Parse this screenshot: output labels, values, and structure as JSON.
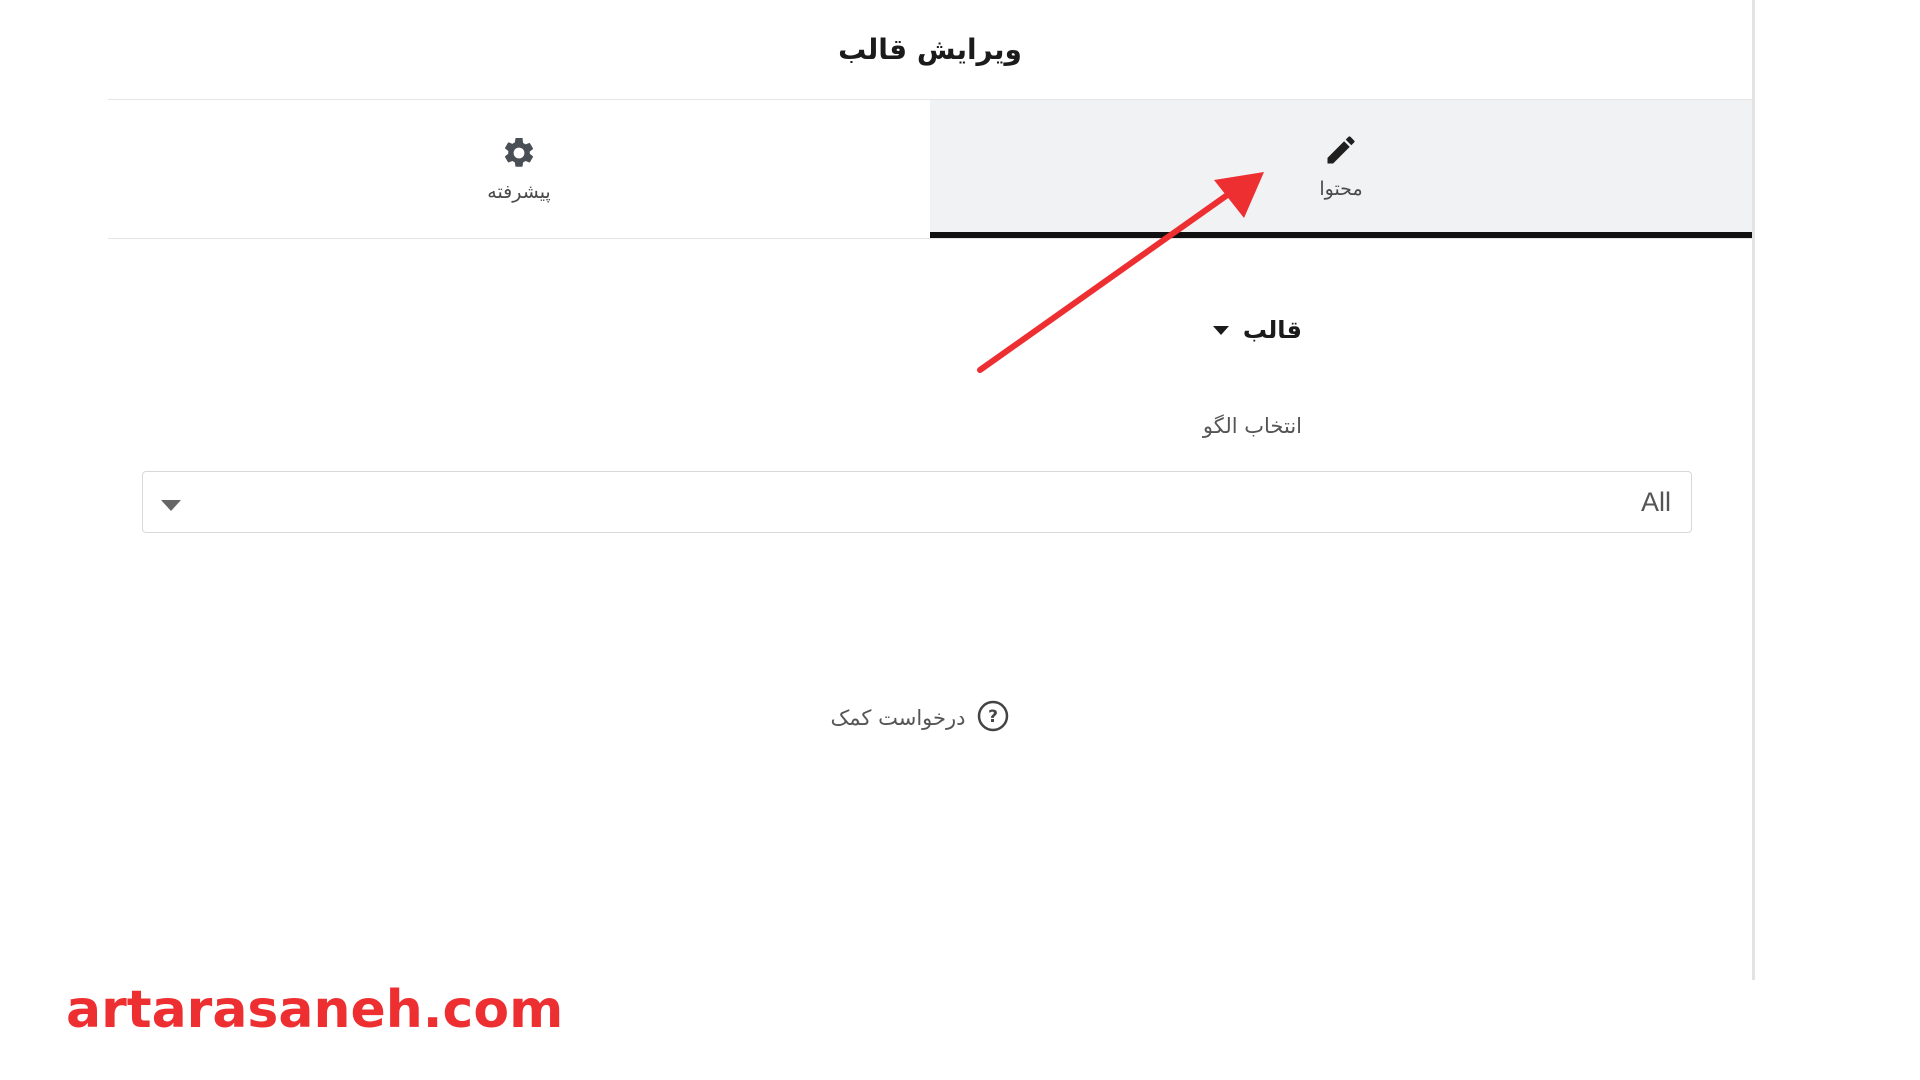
{
  "header": {
    "title": "ویرایش قالب"
  },
  "tabs": [
    {
      "label": "پیشرفته",
      "icon": "gear-icon",
      "active": false
    },
    {
      "label": "محتوا",
      "icon": "pencil-icon",
      "active": true
    }
  ],
  "section": {
    "title": "قالب",
    "icon": "caret-down-icon"
  },
  "field": {
    "label": "انتخاب الگو",
    "value": "All",
    "icon": "chevron-down-icon"
  },
  "help": {
    "label": "درخواست کمک",
    "icon": "question-circle-icon"
  },
  "annotation": {
    "color": "#ee2f32"
  },
  "watermark": {
    "text": "artarasaneh.com",
    "color": "#ee2f32"
  }
}
